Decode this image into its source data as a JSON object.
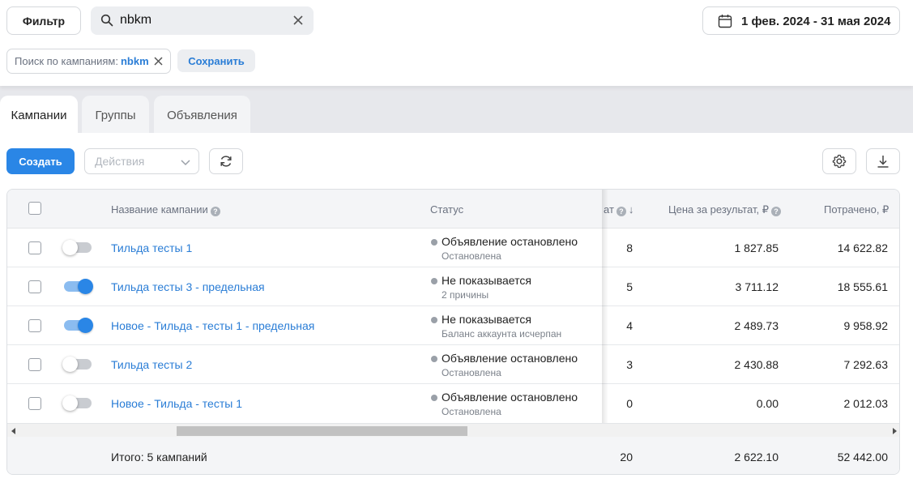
{
  "toolbar": {
    "filter_label": "Фильтр",
    "search_value": "nbkm",
    "date_range": "1 фев. 2024 - 31 мая 2024"
  },
  "filter_chip": {
    "label": "Поиск по кампаниям:",
    "value": "nbkm"
  },
  "save_label": "Сохранить",
  "tabs": [
    {
      "label": "Кампании",
      "active": true
    },
    {
      "label": "Группы",
      "active": false
    },
    {
      "label": "Объявления",
      "active": false
    }
  ],
  "actions": {
    "create_label": "Создать",
    "actions_placeholder": "Действия"
  },
  "table": {
    "headers": {
      "name": "Название кампании",
      "status": "Статус",
      "results_partial": "ат",
      "cost_per_result": "Цена за результат, ₽",
      "spent": "Потрачено, ₽"
    },
    "rows": [
      {
        "enabled": false,
        "name": "Тильда тесты 1",
        "status": "Объявление остановлено",
        "status_detail": "Остановлена",
        "results": "8",
        "cost_per_result": "1 827.85",
        "spent": "14 622.82"
      },
      {
        "enabled": true,
        "name": "Тильда тесты 3 - предельная",
        "status": "Не показывается",
        "status_detail": "2 причины",
        "results": "5",
        "cost_per_result": "3 711.12",
        "spent": "18 555.61"
      },
      {
        "enabled": true,
        "name": "Новое - Тильда - тесты 1 - предельная",
        "status": "Не показывается",
        "status_detail": "Баланс аккаунта исчерпан",
        "results": "4",
        "cost_per_result": "2 489.73",
        "spent": "9 958.92"
      },
      {
        "enabled": false,
        "name": "Тильда тесты 2",
        "status": "Объявление остановлено",
        "status_detail": "Остановлена",
        "results": "3",
        "cost_per_result": "2 430.88",
        "spent": "7 292.63"
      },
      {
        "enabled": false,
        "name": "Новое - Тильда - тесты 1",
        "status": "Объявление остановлено",
        "status_detail": "Остановлена",
        "results": "0",
        "cost_per_result": "0.00",
        "spent": "2 012.03"
      }
    ],
    "footer": {
      "total_label": "Итого: 5 кампаний",
      "results": "20",
      "cost_per_result": "2 622.10",
      "spent": "52 442.00"
    }
  },
  "colors": {
    "accent": "#2a86e6",
    "link": "#2a7dd6"
  }
}
